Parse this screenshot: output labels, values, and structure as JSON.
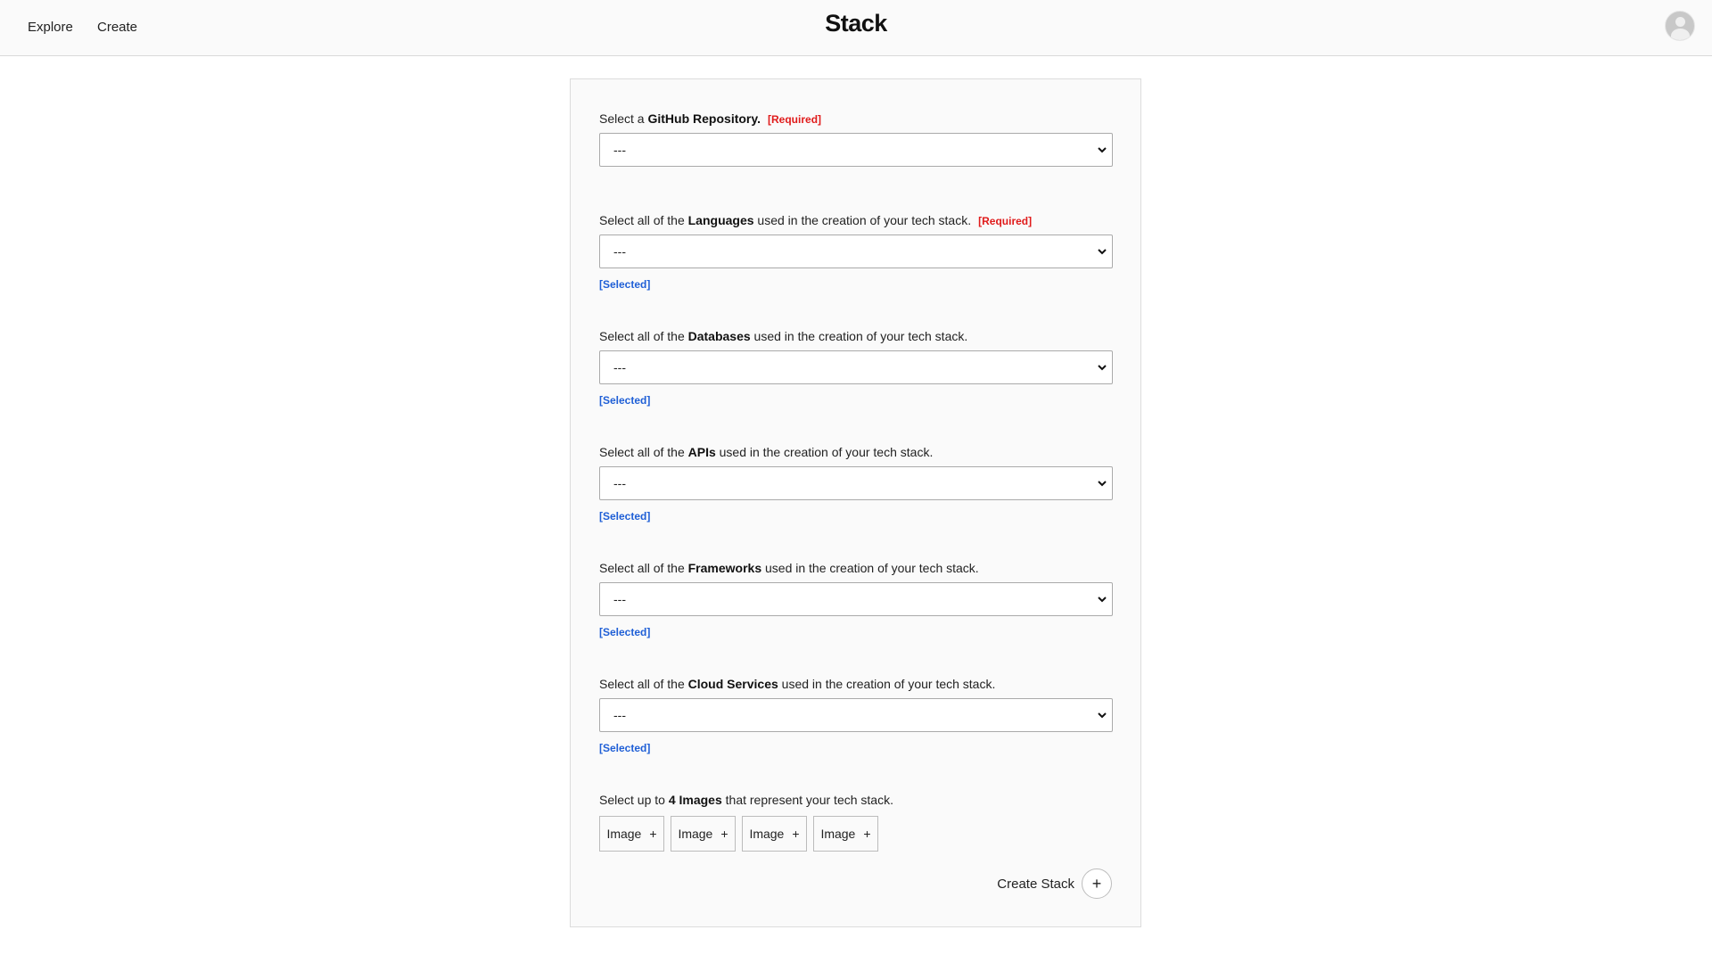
{
  "nav": {
    "explore": "Explore",
    "create": "Create",
    "brand": "Stack"
  },
  "form": {
    "repo": {
      "prefix": "Select a ",
      "bold": "GitHub Repository.",
      "suffix": "",
      "required": "[Required]",
      "value": "---"
    },
    "languages": {
      "prefix": "Select all of the ",
      "bold": "Languages",
      "suffix": " used in the creation of your tech stack.",
      "required": "[Required]",
      "value": "---",
      "selected": "[Selected]"
    },
    "databases": {
      "prefix": "Select all of the ",
      "bold": "Databases",
      "suffix": " used in the creation of your tech stack.",
      "value": "---",
      "selected": "[Selected]"
    },
    "apis": {
      "prefix": "Select all of the ",
      "bold": "APIs",
      "suffix": " used in the creation of your tech stack.",
      "value": "---",
      "selected": "[Selected]"
    },
    "frameworks": {
      "prefix": "Select all of the ",
      "bold": "Frameworks",
      "suffix": " used in the creation of your tech stack.",
      "value": "---",
      "selected": "[Selected]"
    },
    "cloud": {
      "prefix": "Select all of the ",
      "bold": "Cloud Services",
      "suffix": " used in the creation of your tech stack.",
      "value": "---",
      "selected": "[Selected]"
    },
    "images": {
      "prefix": "Select up to ",
      "bold": "4 Images",
      "suffix": " that represent your tech stack.",
      "buttons": [
        "Image",
        "Image",
        "Image",
        "Image"
      ],
      "plus": "+"
    },
    "submit": {
      "label": "Create Stack",
      "icon": "+"
    }
  },
  "colors": {
    "required": "#e01b1b",
    "selected_link": "#1f5fd6"
  },
  "icons": {
    "select": "chevron-down-icon",
    "image": "plus-icon",
    "submit": "plus-icon",
    "avatar": "user-avatar-icon"
  }
}
